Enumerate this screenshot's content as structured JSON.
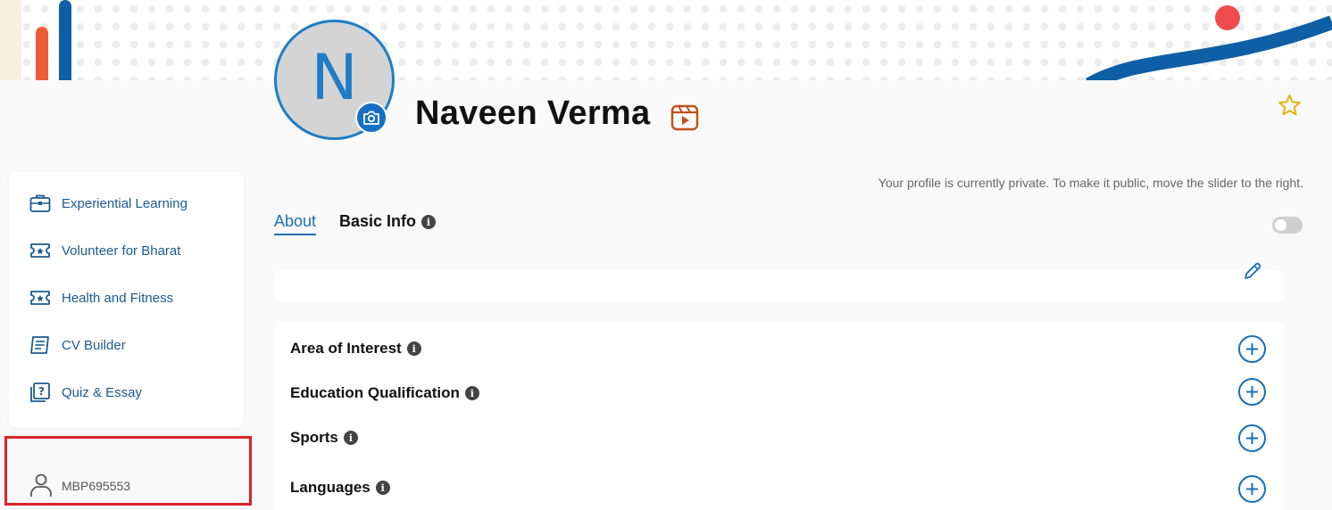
{
  "profile": {
    "avatar_letter": "N",
    "name": "Naveen Verma",
    "privacy_note": "Your profile is currently private. To make it public, move the slider to the right."
  },
  "tabs": [
    {
      "label": "About",
      "active": true
    },
    {
      "label": "Basic Info",
      "active": false
    }
  ],
  "sidebar": {
    "items": [
      {
        "label": "Experiential Learning",
        "icon": "briefcase-icon"
      },
      {
        "label": "Volunteer for Bharat",
        "icon": "ticket-icon"
      },
      {
        "label": "Health and Fitness",
        "icon": "ticket-icon"
      },
      {
        "label": "CV Builder",
        "icon": "document-icon"
      },
      {
        "label": "Quiz & Essay",
        "icon": "quiz-icon"
      }
    ]
  },
  "user": {
    "id": "MBP695553"
  },
  "sections": [
    {
      "label": "Area of Interest"
    },
    {
      "label": "Education Qualification"
    },
    {
      "label": "Sports"
    },
    {
      "label": "Languages"
    }
  ],
  "colors": {
    "accent": "#1a6fb4",
    "sidebar_text": "#1b5a8f",
    "highlight_border": "#d9252a"
  }
}
